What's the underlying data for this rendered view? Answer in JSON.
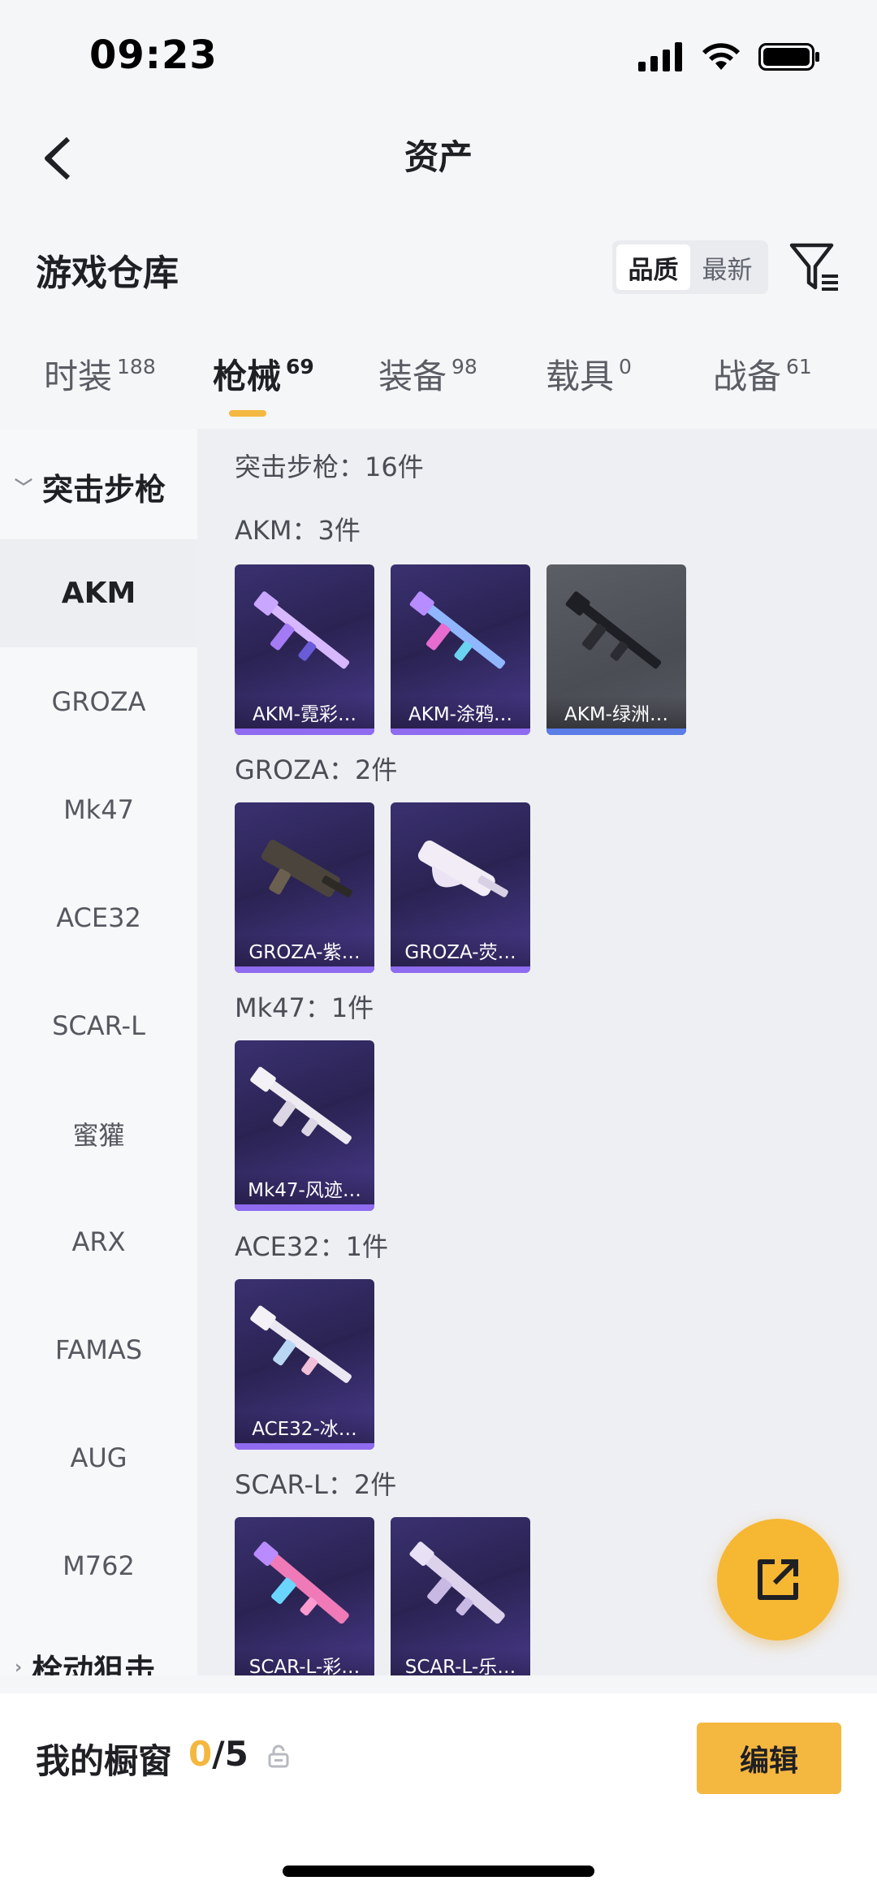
{
  "status_bar": {
    "time": "09:23"
  },
  "nav": {
    "title": "资产"
  },
  "warehouse": {
    "title": "游戏仓库",
    "sort_options": [
      "品质",
      "最新"
    ]
  },
  "tabs": [
    {
      "label": "时装",
      "count": "188"
    },
    {
      "label": "枪械",
      "count": "69"
    },
    {
      "label": "装备",
      "count": "98"
    },
    {
      "label": "载具",
      "count": "0"
    },
    {
      "label": "战备",
      "count": "61"
    }
  ],
  "sidebar": {
    "group_label": "突击步枪",
    "items": [
      "AKM",
      "GROZA",
      "Mk47",
      "ACE32",
      "SCAR-L",
      "蜜獾",
      "ARX",
      "FAMAS",
      "AUG",
      "M762"
    ],
    "next_group_label": "栓动狙击"
  },
  "main": {
    "category_summary": "突击步枪：16件",
    "sections": [
      {
        "header": "AKM：3件",
        "items": [
          "AKM-霓彩…",
          "AKM-涂鸦…",
          "AKM-绿洲…"
        ]
      },
      {
        "header": "GROZA：2件",
        "items": [
          "GROZA-紫…",
          "GROZA-荧…"
        ]
      },
      {
        "header": "Mk47：1件",
        "items": [
          "Mk47-风迹…"
        ]
      },
      {
        "header": "ACE32：1件",
        "items": [
          "ACE32-冰…"
        ]
      },
      {
        "header": "SCAR-L：2件",
        "items": [
          "SCAR-L-彩…",
          "SCAR-L-乐…"
        ]
      }
    ]
  },
  "bottom_bar": {
    "label": "我的橱窗",
    "current": "0",
    "total": "/5",
    "edit_label": "编辑"
  },
  "colors": {
    "accent": "#f4b740",
    "card_purple": "#2a2352",
    "rarity_purple": "#8f6bf0",
    "rarity_blue": "#5a7de6"
  }
}
